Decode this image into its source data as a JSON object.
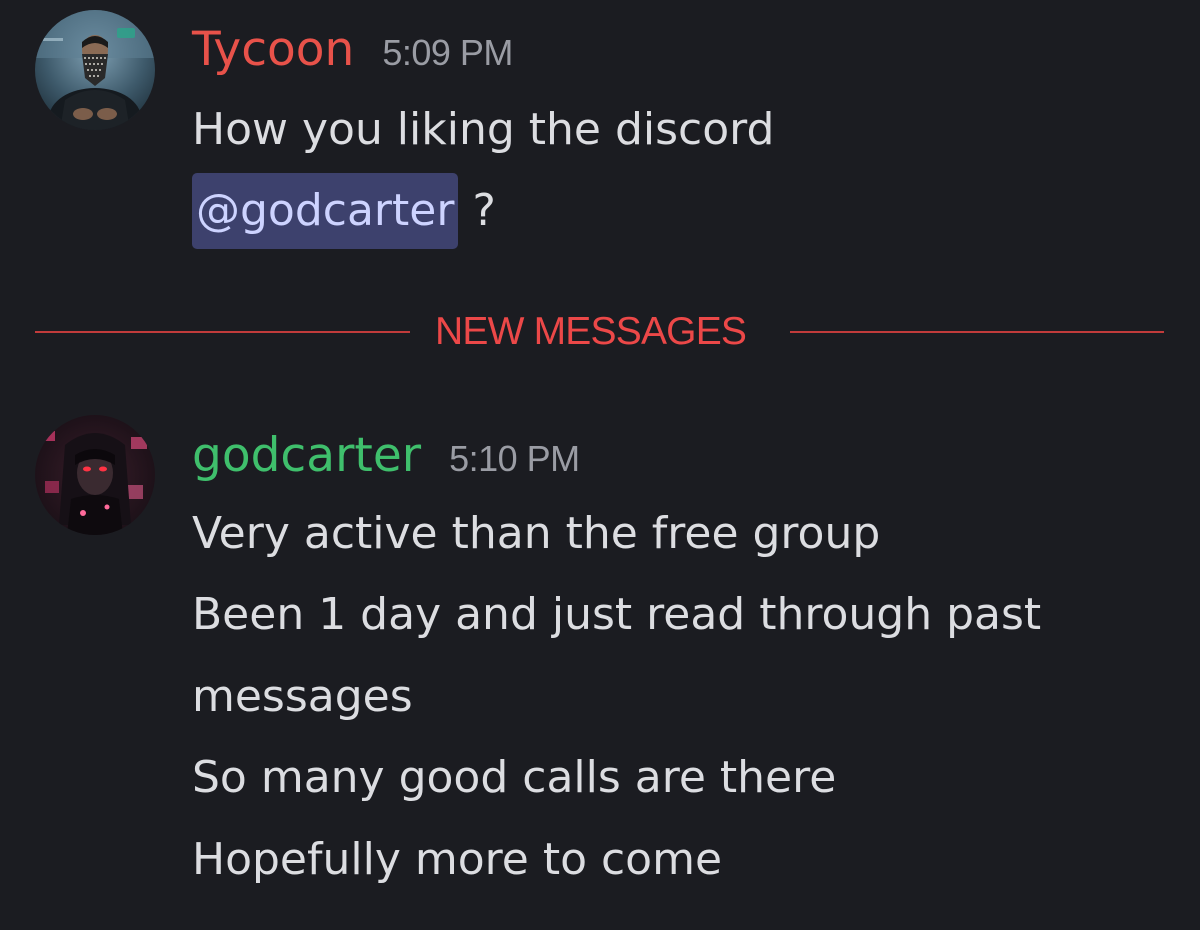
{
  "messages": [
    {
      "username": "Tycoon",
      "timestamp": "5:09 PM",
      "lines": [
        "How you liking the discord",
        "@godcarter",
        "?"
      ],
      "mention": "@godcarter",
      "username_color": "#e8524a",
      "avatar_icon": "masked-man-avatar"
    },
    {
      "username": "godcarter",
      "timestamp": "5:10 PM",
      "lines": [
        "Very active than the free group",
        "Been 1 day and just read through past",
        "messages",
        "So many good calls are there",
        "Hopefully more to come"
      ],
      "username_color": "#3fbf6c",
      "avatar_icon": "anime-character-avatar"
    }
  ],
  "divider": {
    "label": "NEW MESSAGES",
    "color": "#ec4848"
  },
  "theme": {
    "background": "#1b1c21",
    "text": "#dcdde1",
    "mention_background": "#3d416d",
    "mention_text": "#cdd3ff"
  }
}
